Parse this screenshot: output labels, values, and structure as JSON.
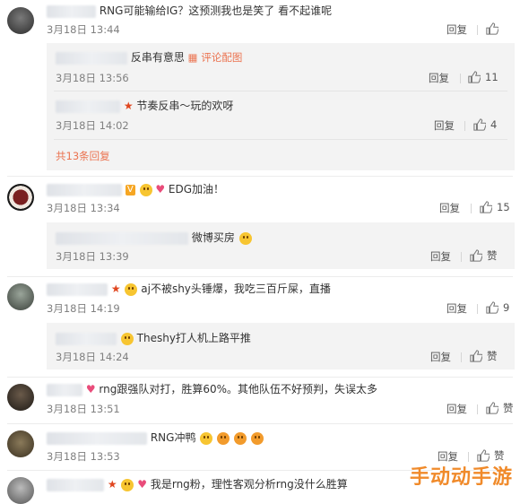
{
  "actions": {
    "reply": "回复"
  },
  "comments": [
    {
      "text": "RNG可能输给IG？这预测我也是笑了 看不起谁呢",
      "time": "3月18日 13:44",
      "likes": ""
    },
    {
      "text": "反串有意思",
      "link": "评论配图",
      "time": "3月18日 13:56",
      "likes": "11"
    },
    {
      "text": "节奏反串～玩的欢呀",
      "time": "3月18日 14:02",
      "likes": "4"
    },
    {
      "more": "共13条回复"
    },
    {
      "text": "EDG加油！",
      "time": "3月18日 13:34",
      "likes": "15"
    },
    {
      "text": "微博买房",
      "time": "3月18日 13:39",
      "likes": "赞"
    },
    {
      "text": "aj不被shy头锤爆，我吃三百斤屎，直播",
      "time": "3月18日 14:19",
      "likes": "9"
    },
    {
      "text": "Theshy打人机上路平推",
      "time": "3月18日 14:24",
      "likes": "赞"
    },
    {
      "text": "rng跟强队对打，胜算60%。其他队伍不好预判，失误太多",
      "time": "3月18日 13:51",
      "likes": "赞"
    },
    {
      "text": "RNG冲鸭",
      "time": "3月18日 13:53",
      "likes": "赞"
    },
    {
      "text": "我是rng粉，理性客观分析rng没什么胜算",
      "time": "",
      "likes": ""
    }
  ],
  "watermark": "手动动手游",
  "colors": {
    "accent": "#eb7350",
    "watermark": "#f08a2a"
  }
}
